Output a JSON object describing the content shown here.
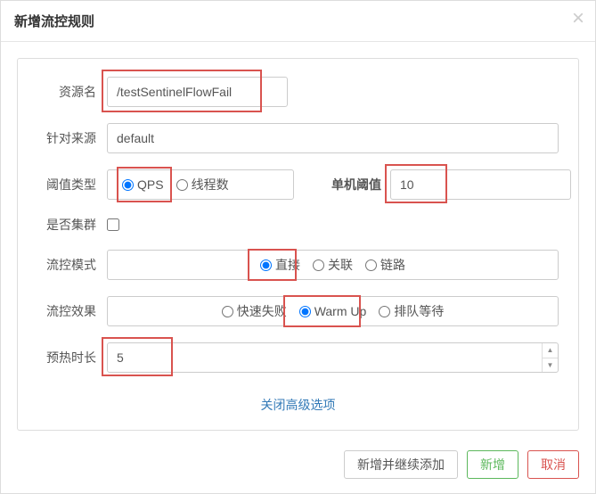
{
  "modal": {
    "title": "新增流控规则",
    "close": "×"
  },
  "form": {
    "resource": {
      "label": "资源名",
      "value": "/testSentinelFlowFail"
    },
    "source": {
      "label": "针对来源",
      "value": "default"
    },
    "thresholdType": {
      "label": "阈值类型",
      "options": {
        "qps": "QPS",
        "threads": "线程数"
      }
    },
    "singleThreshold": {
      "label": "单机阈值",
      "value": "10"
    },
    "cluster": {
      "label": "是否集群"
    },
    "flowMode": {
      "label": "流控模式",
      "options": {
        "direct": "直接",
        "relate": "关联",
        "chain": "链路"
      }
    },
    "flowEffect": {
      "label": "流控效果",
      "options": {
        "fastfail": "快速失败",
        "warmup": "Warm Up",
        "queue": "排队等待"
      }
    },
    "warmupTime": {
      "label": "预热时长",
      "value": "5"
    },
    "advancedLink": "关闭高级选项"
  },
  "footer": {
    "addContinue": "新增并继续添加",
    "add": "新增",
    "cancel": "取消"
  }
}
